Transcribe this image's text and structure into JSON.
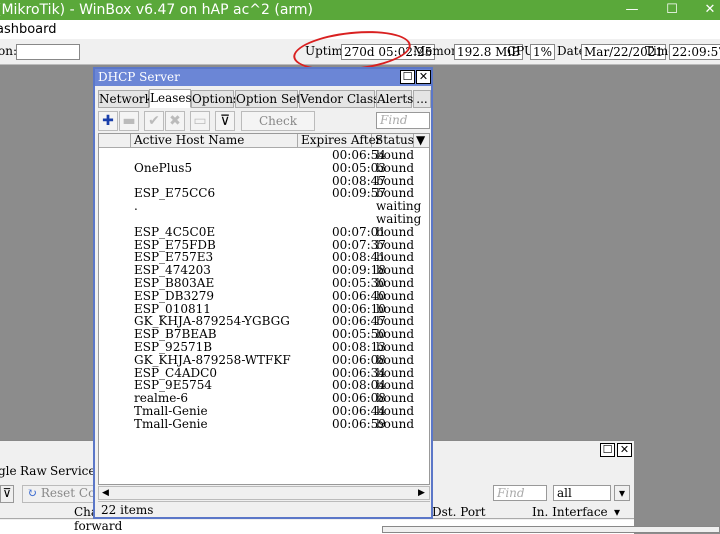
{
  "app": {
    "title": "(MikroTik) - WinBox v6.47 on hAP ac^2 (arm)",
    "menu": "ashboard",
    "controls": {
      "min": "—",
      "max": "☐",
      "close": "✕"
    }
  },
  "status": {
    "tion_label": "on:",
    "uptime_label": "Uptime:",
    "uptime": "270d 05:02:25",
    "memory_label": "Memory:",
    "memory": "192.8 MiB",
    "cpu_label": "CPU:",
    "cpu": "1%",
    "date_label": "Date:",
    "date": "Mar/22/2021",
    "time_label": "Time:",
    "time": "22:09:57"
  },
  "dhcp": {
    "title": "DHCP Server",
    "tabs": [
      "Networks",
      "Leases",
      "Options",
      "Option Sets",
      "Vendor Classes",
      "Alerts",
      "..."
    ],
    "active_tab": "Leases",
    "toolbar": {
      "check_status": "Check Status",
      "find_placeholder": "Find"
    },
    "columns": [
      "Active Host Name",
      "Expires After",
      "Status"
    ],
    "rows": [
      {
        "host": "",
        "expires": "00:06:54",
        "status": "bound"
      },
      {
        "host": "OnePlus5",
        "expires": "00:05:03",
        "status": "bound"
      },
      {
        "host": "",
        "expires": "00:08:47",
        "status": "bound"
      },
      {
        "host": "ESP_E75CC6",
        "expires": "00:09:57",
        "status": "bound"
      },
      {
        "host": ".",
        "expires": "",
        "status": "waiting"
      },
      {
        "host": "",
        "expires": "",
        "status": "waiting"
      },
      {
        "host": "ESP_4C5C0E",
        "expires": "00:07:01",
        "status": "bound"
      },
      {
        "host": "ESP_E75FDB",
        "expires": "00:07:37",
        "status": "bound"
      },
      {
        "host": "ESP_E757E3",
        "expires": "00:08:41",
        "status": "bound"
      },
      {
        "host": "ESP_474203",
        "expires": "00:09:18",
        "status": "bound"
      },
      {
        "host": "ESP_B803AE",
        "expires": "00:05:30",
        "status": "bound"
      },
      {
        "host": "ESP_DB3279",
        "expires": "00:06:40",
        "status": "bound"
      },
      {
        "host": "ESP_010811",
        "expires": "00:06:10",
        "status": "bound"
      },
      {
        "host": "GK_KHJA-879254-YGBGG",
        "expires": "00:06:47",
        "status": "bound"
      },
      {
        "host": "ESP_B7BEAB",
        "expires": "00:05:50",
        "status": "bound"
      },
      {
        "host": "ESP_92571B",
        "expires": "00:08:13",
        "status": "bound"
      },
      {
        "host": "GK_KHJA-879258-WTFKF",
        "expires": "00:06:08",
        "status": "bound"
      },
      {
        "host": "ESP_C4ADC0",
        "expires": "00:06:34",
        "status": "bound"
      },
      {
        "host": "ESP_9E5754",
        "expires": "00:08:04",
        "status": "bound"
      },
      {
        "host": "realme-6",
        "expires": "00:06:08",
        "status": "bound"
      },
      {
        "host": "Tmall-Genie",
        "expires": "00:06:44",
        "status": "bound"
      },
      {
        "host": "Tmall-Genie",
        "expires": "00:06:59",
        "status": "bound"
      }
    ],
    "count": "22 items"
  },
  "bg": {
    "tabs": [
      "gle",
      "Raw",
      "Service Po"
    ],
    "reset": "Reset Count",
    "find": "Find",
    "filter": "all",
    "col1": "Cha",
    "row1": "forward",
    "dst_port": "Dst. Port",
    "in_iface": "In. Interface"
  }
}
